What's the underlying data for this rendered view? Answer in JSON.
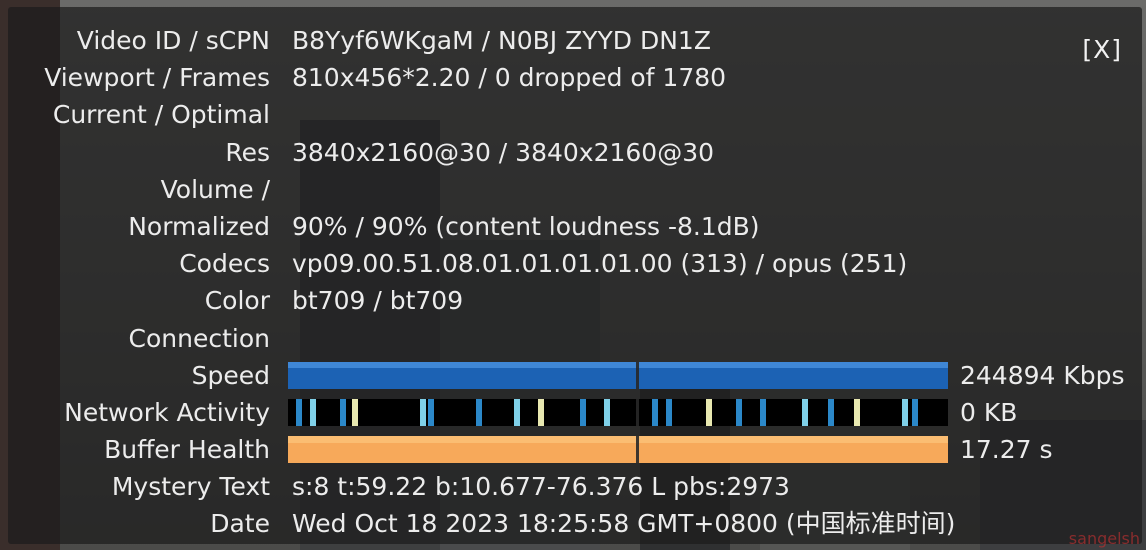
{
  "panel": {
    "close_label": "[X]",
    "rows": [
      {
        "label": "Video ID / sCPN",
        "value": "B8Yyf6WKgaM / N0BJ ZYYD DN1Z"
      },
      {
        "label": "Viewport / Frames",
        "value": "810x456*2.20 / 0 dropped of 1780"
      },
      {
        "label": "Current / Optimal",
        "value": ""
      },
      {
        "label": "Res",
        "value": "3840x2160@30 / 3840x2160@30"
      },
      {
        "label": "Volume /",
        "value": ""
      },
      {
        "label": "Normalized",
        "value": "90% / 90% (content loudness -8.1dB)"
      },
      {
        "label": "Codecs",
        "value": "vp09.00.51.08.01.01.01.01.00 (313) / opus (251)"
      },
      {
        "label": "Color",
        "value": "bt709 / bt709"
      },
      {
        "label": "Connection",
        "value": ""
      },
      {
        "label": "Speed",
        "value": "244894 Kbps"
      },
      {
        "label": "Network Activity",
        "value": "0 KB"
      },
      {
        "label": "Buffer Health",
        "value": "17.27 s"
      },
      {
        "label": "Mystery Text",
        "value": "s:8 t:59.22 b:10.677-76.376 L pbs:2973"
      },
      {
        "label": "Date",
        "value": "Wed Oct 18 2023 18:25:58 GMT+0800 (中国标准时间)"
      }
    ]
  },
  "colors": {
    "speed_bar": "#1c62b4",
    "network_bar": "#2b88c9",
    "buffer_bar": "#f7a95a"
  },
  "watermark": "sangelsh"
}
